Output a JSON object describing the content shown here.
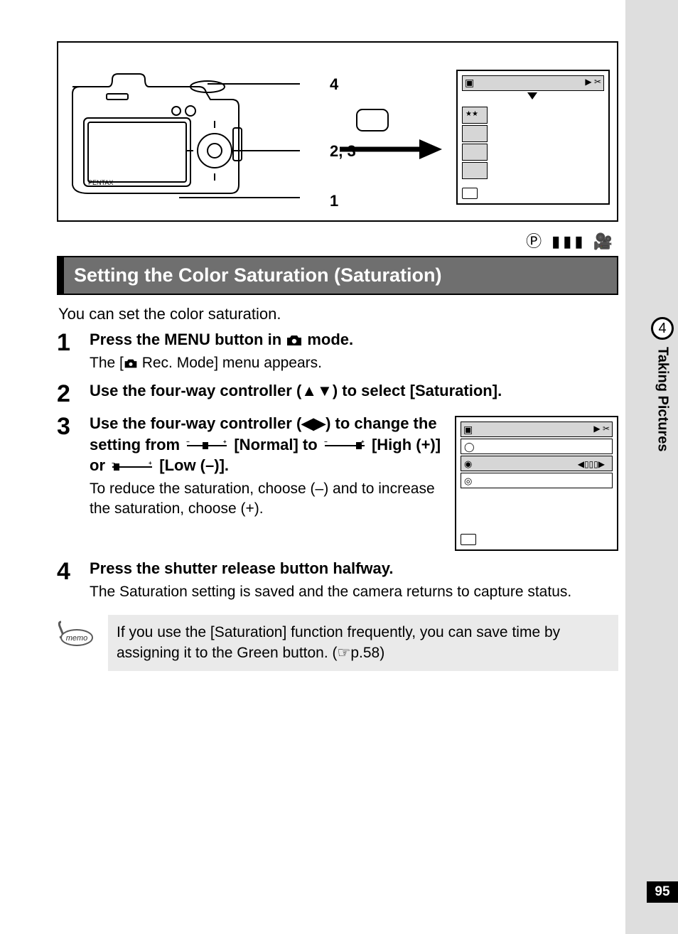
{
  "diagram": {
    "labels": {
      "top": "4",
      "mid": "2, 3",
      "bottom": "1"
    },
    "brand": "PENTAX",
    "screen_stars": "★★"
  },
  "mode_icons_row": "Ⓟ ▮▮▮ 🎥",
  "section_heading": "Setting the Color Saturation (Saturation)",
  "intro": "You can set the color saturation.",
  "steps": [
    {
      "num": "1",
      "title_pre": "Press the ",
      "title_bold": "MENU",
      "title_mid": " button in ",
      "title_post": " mode.",
      "desc_pre": "The [",
      "desc_post": " Rec. Mode] menu appears."
    },
    {
      "num": "2",
      "title": "Use the four-way controller (▲▼) to select [Saturation]."
    },
    {
      "num": "3",
      "title_line1": "Use the four-way controller (◀▶) to change the setting from ",
      "normal_label": " [Normal] to ",
      "high_label": " [High (+)] or ",
      "low_label": " [Low (–)].",
      "desc": "To reduce the saturation, choose (–) and to increase the saturation, choose (+)."
    },
    {
      "num": "4",
      "title": "Press the shutter release button halfway.",
      "desc": "The Saturation setting is saved and the camera returns to capture status."
    }
  ],
  "memo": {
    "label": "memo",
    "text_pre": "If you use the [Saturation] function frequently, you can save time by assigning it to the Green button. (",
    "page_ref": "☞p.58",
    "text_post": ")"
  },
  "sidebar": {
    "chapter_num": "4",
    "chapter_title": "Taking Pictures"
  },
  "page_number": "95",
  "step3_screen_indicator": "◀▯▯▯▶"
}
